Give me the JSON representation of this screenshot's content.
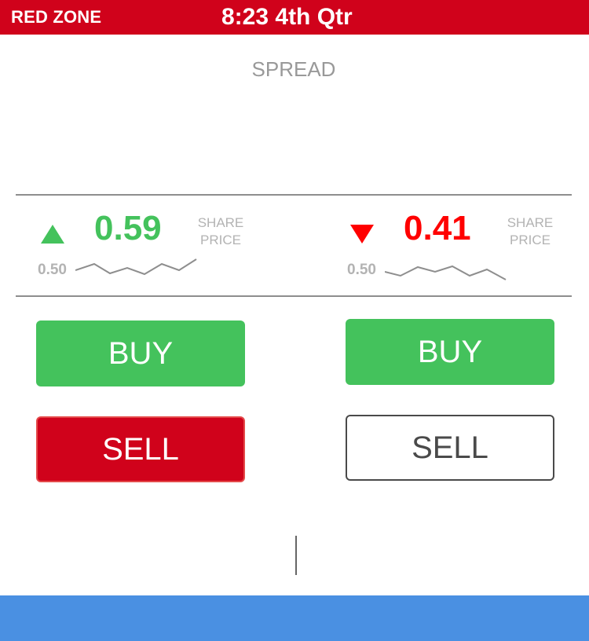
{
  "header": {
    "zone_label": "RED ZONE",
    "game_clock": "8:23 4th Qtr"
  },
  "market": {
    "title": "SPREAD",
    "left": {
      "direction": "up",
      "price": "0.59",
      "share_label_line1": "SHARE",
      "share_label_line2": "PRICE",
      "baseline": "0.50",
      "buy_label": "BUY",
      "sell_label": "SELL"
    },
    "right": {
      "direction": "down",
      "price": "0.41",
      "share_label_line1": "SHARE",
      "share_label_line2": "PRICE",
      "baseline": "0.50",
      "buy_label": "BUY",
      "sell_label": "SELL"
    }
  },
  "colors": {
    "brand_red": "#d0021b",
    "up_green": "#44c25c",
    "down_red": "#ff0000",
    "muted_text": "#999999",
    "bottom_bar_blue": "#4a90e2"
  }
}
